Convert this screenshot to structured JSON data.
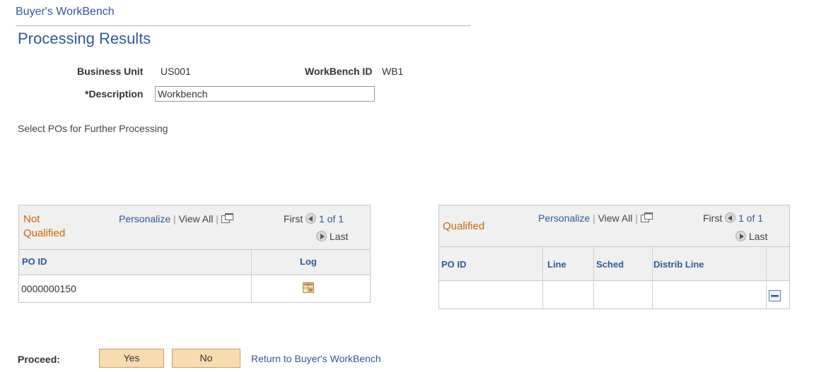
{
  "app": {
    "title": "Buyer's WorkBench"
  },
  "page": {
    "title": "Processing Results"
  },
  "form": {
    "business_unit_label": "Business Unit",
    "business_unit_value": "US001",
    "workbench_id_label": "WorkBench ID",
    "workbench_id_value": "WB1",
    "description_label": "*Description",
    "description_value": "Workbench",
    "instructions": "Select POs for Further Processing"
  },
  "not_qualified": {
    "title_line1": "Not",
    "title_line2": "Qualified",
    "personalize": "Personalize",
    "view_all": "View All",
    "first": "First",
    "range": "1 of 1",
    "last": "Last",
    "columns": [
      "PO ID",
      "Log"
    ],
    "rows": [
      {
        "po_id": "0000000150",
        "log_icon": "log-grid-icon"
      }
    ]
  },
  "qualified": {
    "title": "Qualified",
    "personalize": "Personalize",
    "view_all": "View All",
    "first": "First",
    "range": "1 of 1",
    "last": "Last",
    "columns": [
      "PO ID",
      "Line",
      "Sched",
      "Distrib Line"
    ],
    "rows": [
      {
        "po_id": "",
        "line": "",
        "sched": "",
        "distrib_line": "",
        "action_icon": "delete-row-icon"
      }
    ]
  },
  "footer": {
    "proceed_label": "Proceed:",
    "yes": "Yes",
    "no": "No",
    "return_link": "Return to Buyer's WorkBench"
  },
  "colors": {
    "link": "#2e5a99",
    "grid_title": "#cc6600",
    "button_bg": "#f8dcb0"
  }
}
